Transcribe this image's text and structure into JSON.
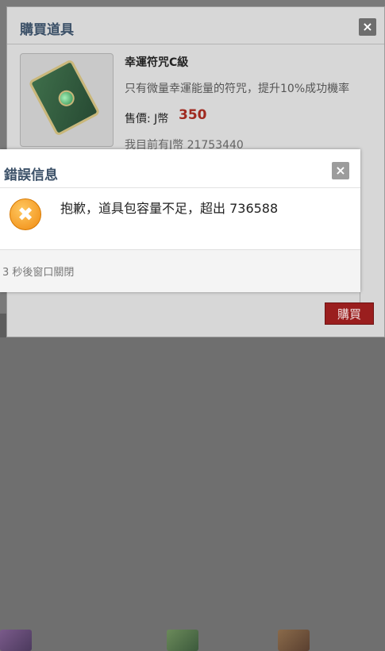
{
  "purchase_dialog": {
    "title": "購買道具",
    "close_label": "×",
    "item": {
      "name": "幸運符咒C級",
      "description": "只有微量幸運能量的符咒，提升10%成功機率",
      "price_label": "售價: J幣",
      "price_value": "350",
      "balance_text": "我目前有J幣 21753440"
    },
    "buy_button_label": "購買"
  },
  "error_dialog": {
    "title": "錯誤信息",
    "close_label": "×",
    "icon_glyph": "✖",
    "message": "抱歉，道具包容量不足，超出 736588",
    "countdown_text": "3 秒後窗口關閉"
  },
  "colors": {
    "title_blue": "#3c5168",
    "price_red": "#a02a20",
    "buy_button_red": "#9a1e1e",
    "error_icon_orange": "#f08a10"
  },
  "icons": {
    "item": "lucky-charm-card-icon",
    "error": "error-x-icon",
    "close": "close-icon"
  }
}
